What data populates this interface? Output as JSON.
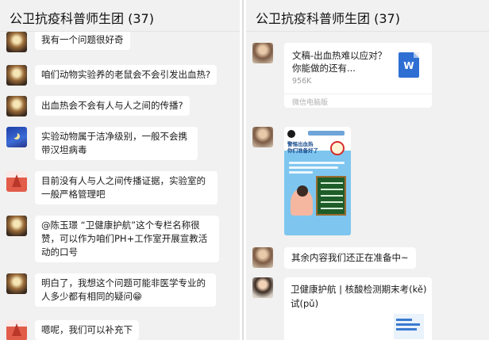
{
  "left": {
    "title": "公卫抗疫科普师生团 (37)",
    "messages": [
      {
        "avatar": "moon-avatar",
        "text": "我有一个问题很好奇"
      },
      {
        "avatar": "moon-avatar",
        "text": "咱们动物实验养的老鼠会不会引发出血热?"
      },
      {
        "avatar": "moon-avatar",
        "text": "出血热会不会有人与人之间的传播?"
      },
      {
        "avatar": "blue-avatar",
        "text": "实验动物属于洁净级别，一般不会携带汉坦病毒"
      },
      {
        "avatar": "tree-avatar",
        "text": "目前没有人与人之间传播证据，实验室的一般严格管理吧"
      },
      {
        "avatar": "moon-avatar",
        "text": "@陈玉璟 “卫健康护航”这个专栏名称很赞，可以作为咱们PH+工作室开展宣教活动的口号"
      },
      {
        "avatar": "moon-avatar",
        "text": "明白了，我想这个问题可能非医学专业的人多少都有相同的疑问😁"
      },
      {
        "avatar": "tree-avatar",
        "text": "嗯呢，我们可以补充下"
      }
    ]
  },
  "right": {
    "title": "公卫抗疫科普师生团 (37)",
    "file": {
      "name": "文稿-出血热难以应对？你能做的还有...",
      "size": "956K",
      "source": "微信电脑版",
      "icon": "word-icon",
      "icon_letter": "W"
    },
    "poster": {
      "title": "警惕出血热\n你们准备好了"
    },
    "text_message": "其余内容我们还正在准备中~",
    "link": {
      "title": "卫健康护航 | 核酸检测期末考(kě)试(pǔ)"
    }
  }
}
